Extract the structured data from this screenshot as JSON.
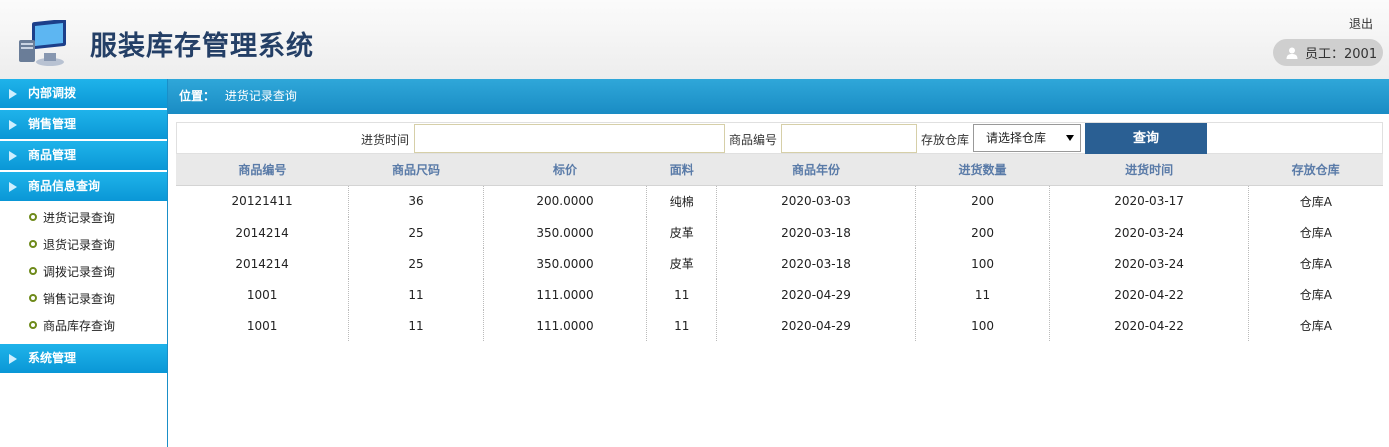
{
  "header": {
    "title": "服装库存管理系统",
    "logout": "退出",
    "user": "员工：2001"
  },
  "sidebar": {
    "menus": [
      {
        "label": "内部调拨"
      },
      {
        "label": "销售管理"
      },
      {
        "label": "商品管理"
      },
      {
        "label": "商品信息查询",
        "children": [
          "进货记录查询",
          "退货记录查询",
          "调拨记录查询",
          "销售记录查询",
          "商品库存查询"
        ]
      },
      {
        "label": "系统管理"
      }
    ]
  },
  "location": {
    "label": "位置：",
    "path": "进货记录查询"
  },
  "search": {
    "time_label": "进货时间",
    "time_value": "",
    "code_label": "商品编号",
    "code_value": "",
    "warehouse_label": "存放仓库",
    "warehouse_selected": "请选择仓库",
    "query_button": "查询"
  },
  "table": {
    "columns": [
      "商品编号",
      "商品尺码",
      "标价",
      "面料",
      "商品年份",
      "进货数量",
      "进货时间",
      "存放仓库"
    ],
    "rows": [
      [
        "20121411",
        "36",
        "200.0000",
        "纯棉",
        "2020-03-03",
        "200",
        "2020-03-17",
        "仓库A"
      ],
      [
        "2014214",
        "25",
        "350.0000",
        "皮革",
        "2020-03-18",
        "200",
        "2020-03-24",
        "仓库A"
      ],
      [
        "2014214",
        "25",
        "350.0000",
        "皮革",
        "2020-03-18",
        "100",
        "2020-03-24",
        "仓库A"
      ],
      [
        "1001",
        "11",
        "111.0000",
        "11",
        "2020-04-29",
        "11",
        "2020-04-22",
        "仓库A"
      ],
      [
        "1001",
        "11",
        "111.0000",
        "11",
        "2020-04-29",
        "100",
        "2020-04-22",
        "仓库A"
      ]
    ]
  },
  "colors": {
    "accent": "#1a8cc4",
    "menu": "#0a97d6",
    "button": "#2a5f93",
    "title": "#243f66"
  }
}
